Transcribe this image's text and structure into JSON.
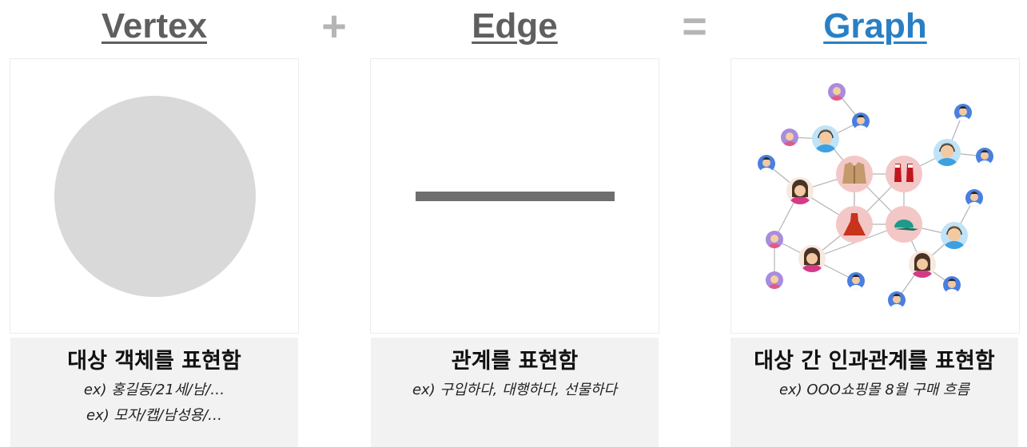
{
  "headings": {
    "vertex": "Vertex",
    "plus": "+",
    "edge": "Edge",
    "equals": "=",
    "graph": "Graph"
  },
  "captions": {
    "vertex": {
      "title": "대상 객체를 표현함",
      "examples": [
        "ex) 홍길동/21세/남/…",
        "ex) 모자/캡/남성용/…"
      ]
    },
    "edge": {
      "title": "관계를 표현함",
      "examples": [
        "ex) 구입하다, 대행하다, 선물하다"
      ]
    },
    "graph": {
      "title": "대상 간 인과관계를 표현함",
      "examples": [
        "ex) OOO쇼핑몰 8월 구매 흐름"
      ]
    }
  },
  "colors": {
    "heading_gray": "#5f5f5f",
    "graph_blue": "#2a7fc4",
    "operator_gray": "#b5b5b5",
    "vertex_fill": "#d9d9d9",
    "edge_fill": "#6e6e6e",
    "caption_bg": "#f2f2f2",
    "product_node": "#f4c7c7"
  },
  "graph_illustration": {
    "products": [
      "jacket-icon",
      "sneakers-icon",
      "dress-icon",
      "cap-icon"
    ],
    "person_types": [
      "blonde-woman-avatar",
      "man-avatar",
      "headset-man-avatar",
      "headset-woman-avatar"
    ]
  }
}
